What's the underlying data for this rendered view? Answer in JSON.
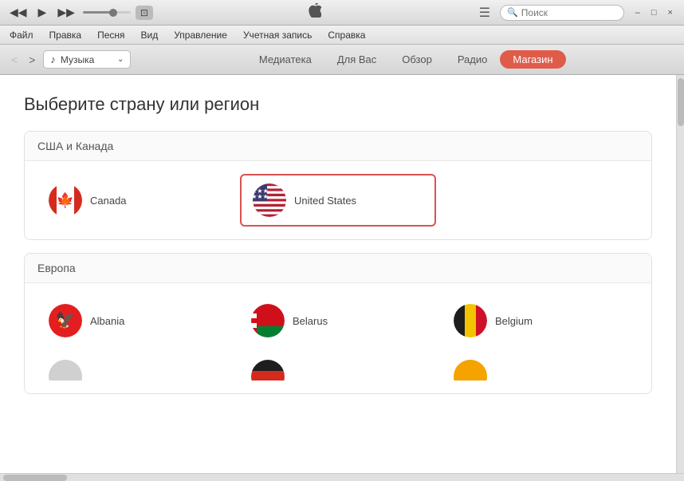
{
  "titleBar": {
    "transport": {
      "rewind": "◀◀",
      "play": "▶",
      "forward": "▶▶"
    },
    "airplay": "□",
    "appleLogo": "",
    "search": {
      "placeholder": "Поиск"
    },
    "windowControls": {
      "minimize": "–",
      "maximize": "□",
      "close": "×"
    }
  },
  "menuBar": {
    "items": [
      {
        "label": "Файл"
      },
      {
        "label": "Правка"
      },
      {
        "label": "Песня"
      },
      {
        "label": "Вид"
      },
      {
        "label": "Управление"
      },
      {
        "label": "Учетная запись"
      },
      {
        "label": "Справка"
      }
    ]
  },
  "navBar": {
    "backLabel": "<",
    "forwardLabel": ">",
    "sourceLabel": "Музыка",
    "tabs": [
      {
        "label": "Медиатека",
        "active": false
      },
      {
        "label": "Для Вас",
        "active": false
      },
      {
        "label": "Обзор",
        "active": false
      },
      {
        "label": "Радио",
        "active": false
      },
      {
        "label": "Магазин",
        "active": true
      }
    ]
  },
  "page": {
    "title": "Выберите страну или регион",
    "sections": [
      {
        "header": "США и Канада",
        "countries": [
          {
            "name": "Canada",
            "flag": "canada",
            "selected": false
          },
          {
            "name": "United States",
            "flag": "us",
            "selected": true
          }
        ]
      },
      {
        "header": "Европа",
        "countries": [
          {
            "name": "Albania",
            "flag": "albania",
            "selected": false
          },
          {
            "name": "Belarus",
            "flag": "belarus",
            "selected": false
          },
          {
            "name": "Belgium",
            "flag": "belgium",
            "selected": false
          }
        ]
      }
    ]
  }
}
